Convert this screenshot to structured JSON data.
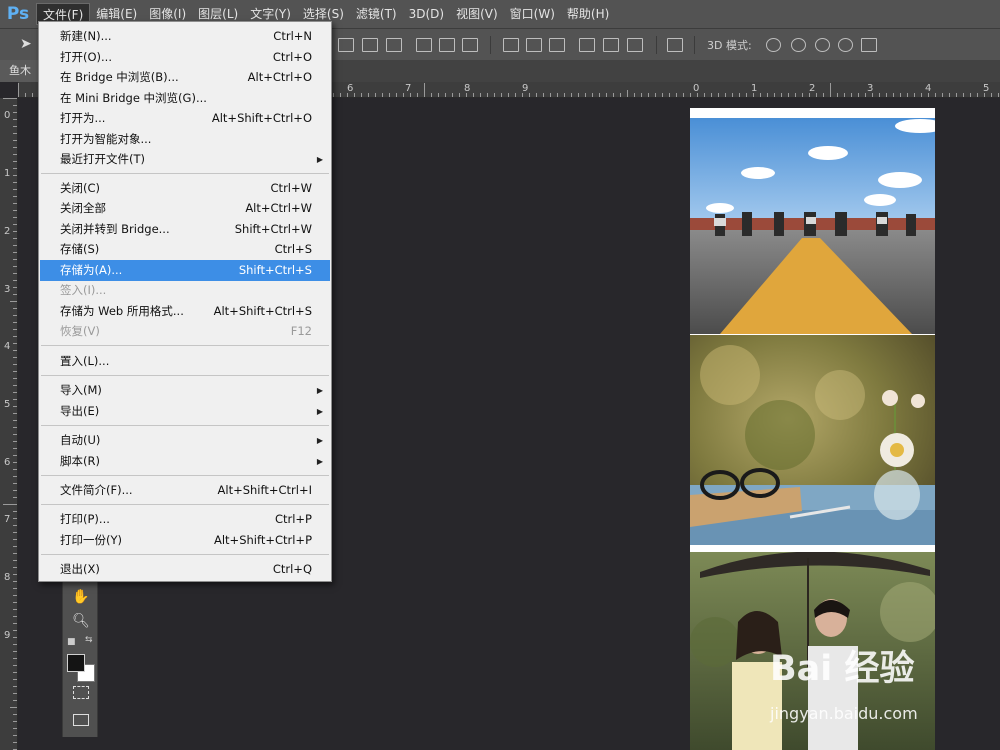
{
  "app": {
    "logo": "Ps"
  },
  "menubar": {
    "items": [
      {
        "label": "文件(F)",
        "active": true
      },
      {
        "label": "编辑(E)"
      },
      {
        "label": "图像(I)"
      },
      {
        "label": "图层(L)"
      },
      {
        "label": "文字(Y)"
      },
      {
        "label": "选择(S)"
      },
      {
        "label": "滤镜(T)"
      },
      {
        "label": "3D(D)"
      },
      {
        "label": "视图(V)"
      },
      {
        "label": "窗口(W)"
      },
      {
        "label": "帮助(H)"
      }
    ]
  },
  "options_bar": {
    "mode_3d_label": "3D 模式:"
  },
  "document_tab": {
    "title": "鱼木"
  },
  "rulers": {
    "top": [
      "6",
      "7",
      "8",
      "9",
      "0",
      "1",
      "2",
      "3",
      "4",
      "5"
    ],
    "left": [
      "0",
      "1",
      "2",
      "3",
      "4",
      "5",
      "6",
      "7",
      "8",
      "9"
    ]
  },
  "file_menu": {
    "items": [
      {
        "label": "新建(N)...",
        "shortcut": "Ctrl+N"
      },
      {
        "label": "打开(O)...",
        "shortcut": "Ctrl+O"
      },
      {
        "label": "在 Bridge 中浏览(B)...",
        "shortcut": "Alt+Ctrl+O"
      },
      {
        "label": "在 Mini Bridge 中浏览(G)...",
        "shortcut": ""
      },
      {
        "label": "打开为...",
        "shortcut": "Alt+Shift+Ctrl+O"
      },
      {
        "label": "打开为智能对象...",
        "shortcut": ""
      },
      {
        "label": "最近打开文件(T)",
        "shortcut": "",
        "submenu": true
      },
      {
        "label": "关闭(C)",
        "shortcut": "Ctrl+W"
      },
      {
        "label": "关闭全部",
        "shortcut": "Alt+Ctrl+W"
      },
      {
        "label": "关闭并转到 Bridge...",
        "shortcut": "Shift+Ctrl+W"
      },
      {
        "label": "存储(S)",
        "shortcut": "Ctrl+S"
      },
      {
        "label": "存储为(A)...",
        "shortcut": "Shift+Ctrl+S",
        "highlighted": true
      },
      {
        "label": "签入(I)...",
        "shortcut": "",
        "disabled": true
      },
      {
        "label": "存储为 Web 所用格式...",
        "shortcut": "Alt+Shift+Ctrl+S"
      },
      {
        "label": "恢复(V)",
        "shortcut": "F12",
        "disabled": true
      },
      {
        "label": "置入(L)...",
        "shortcut": ""
      },
      {
        "label": "导入(M)",
        "shortcut": "",
        "submenu": true
      },
      {
        "label": "导出(E)",
        "shortcut": "",
        "submenu": true
      },
      {
        "label": "自动(U)",
        "shortcut": "",
        "submenu": true
      },
      {
        "label": "脚本(R)",
        "shortcut": "",
        "submenu": true
      },
      {
        "label": "文件简介(F)...",
        "shortcut": "Alt+Shift+Ctrl+I"
      },
      {
        "label": "打印(P)...",
        "shortcut": "Ctrl+P"
      },
      {
        "label": "打印一份(Y)",
        "shortcut": "Alt+Shift+Ctrl+P"
      },
      {
        "label": "退出(X)",
        "shortcut": "Ctrl+Q"
      }
    ]
  },
  "watermark": {
    "brand": "Bai 经验",
    "url": "jingyan.baidu.com"
  },
  "colors": {
    "accent": "#3d8ee6",
    "logo": "#5fb1f4",
    "canvas_bg": "#28272b"
  }
}
